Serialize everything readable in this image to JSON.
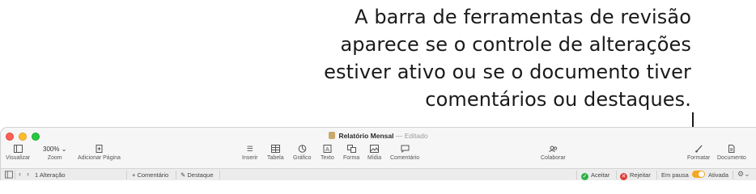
{
  "callout": {
    "lines": [
      "A barra de ferramentas de revisão",
      "aparece se o controle de alterações",
      "estiver ativo ou se o documento tiver",
      "comentários ou destaques."
    ]
  },
  "window": {
    "title": "Relatório Mensal",
    "title_separator": "—",
    "status": "Editado"
  },
  "toolbar": {
    "visualizar": "Visualizar",
    "zoom_value": "300%",
    "zoom": "Zoom",
    "adicionar_pagina": "Adicionar Página",
    "inserir": "Inserir",
    "tabela": "Tabela",
    "grafico": "Gráfico",
    "texto": "Texto",
    "forma": "Forma",
    "midia": "Mídia",
    "comentario": "Comentário",
    "colaborar": "Colaborar",
    "formatar": "Formatar",
    "documento": "Documento"
  },
  "review_bar": {
    "changes_count": "1 Alteração",
    "add_comment": "+ Comentário",
    "highlight": "Destaque",
    "accept": "Aceitar",
    "reject": "Rejeitar",
    "pause_label": "Em pausa",
    "active_label": "Ativada",
    "toggle_color": "#f5a623",
    "accept_color": "#2fb14a",
    "reject_color": "#e23b33"
  }
}
